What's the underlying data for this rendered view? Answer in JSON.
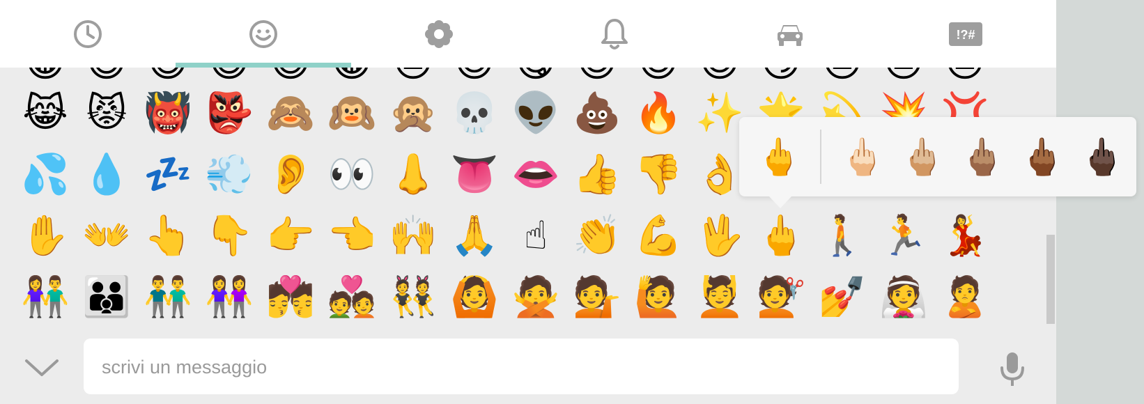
{
  "colors": {
    "tab_icon": "#9e9e9e",
    "tab_indicator": "#8fd1c8",
    "panel_bg": "#ececec",
    "popup_bg": "#f6f6f6"
  },
  "tabs": [
    {
      "icon": "clock-icon",
      "selected": false
    },
    {
      "icon": "smiley-icon",
      "selected": true
    },
    {
      "icon": "flower-icon",
      "selected": false
    },
    {
      "icon": "bell-icon",
      "selected": false
    },
    {
      "icon": "car-icon",
      "selected": false
    },
    {
      "icon": "symbols-icon",
      "label": "!?#",
      "selected": false
    }
  ],
  "emoji_rows": [
    [
      "😹",
      "😾",
      "👹",
      "👺",
      "🙈",
      "🙉",
      "🙊",
      "💀",
      "👽",
      "💩",
      "🔥",
      "✨",
      "🌟",
      "💫",
      "💥",
      "💢"
    ],
    [
      "💦",
      "💧",
      "💤",
      "💨",
      "👂",
      "👀",
      "👃",
      "👅",
      "👄",
      "👍",
      "👎",
      "👌",
      "👊",
      "✊",
      "✌",
      "👋"
    ],
    [
      "✋",
      "👐",
      "👆",
      "👇",
      "👉",
      "👈",
      "🙌",
      "🙏",
      "☝",
      "👏",
      "💪",
      "🖖",
      "🖕",
      "🚶",
      "🏃",
      "💃"
    ],
    [
      "👫",
      "👪",
      "👬",
      "👭",
      "💏",
      "💑",
      "👯",
      "🙆",
      "🙅",
      "💁",
      "🙋",
      "💆",
      "💇",
      "💅",
      "👰",
      "🙎"
    ]
  ],
  "peek_row": [
    "😂",
    "😆",
    "😅",
    "😄",
    "😃",
    "😀",
    "😑",
    "😊",
    "😋",
    "😌",
    "😍",
    "😎",
    "😏",
    "😐",
    "😒",
    "😓"
  ],
  "skin_tone_popup": {
    "base": "🖕",
    "variants": [
      "🖕🏻",
      "🖕🏼",
      "🖕🏽",
      "🖕🏾",
      "🖕🏿"
    ]
  },
  "input": {
    "placeholder": "scrivi un messaggio",
    "value": ""
  }
}
